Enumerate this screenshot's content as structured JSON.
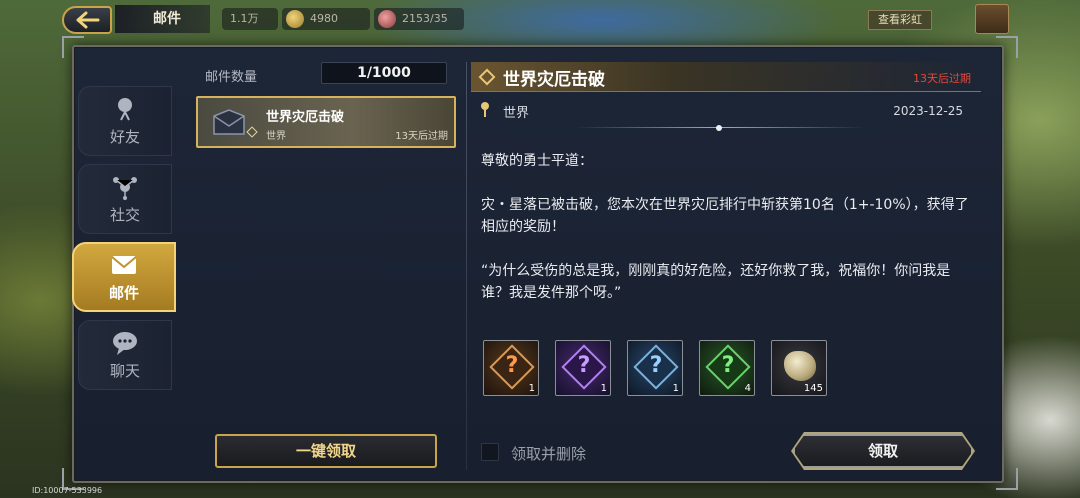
{
  "topbar": {
    "title": "邮件",
    "resource_1": "1.1万",
    "resource_2": "4980",
    "resource_3": "2153/35",
    "map_label": "查看彩虹"
  },
  "nav": {
    "items": [
      {
        "label": "好友",
        "icon": "pin-icon",
        "active": false
      },
      {
        "label": "社交",
        "icon": "network-icon",
        "active": false
      },
      {
        "label": "邮件",
        "icon": "envelope-icon",
        "active": true
      },
      {
        "label": "聊天",
        "icon": "speech-bubble-icon",
        "active": false
      }
    ]
  },
  "list": {
    "count_label": "邮件数量",
    "count_value": "1/1000",
    "items": [
      {
        "title": "世界灾厄击破",
        "source": "世界",
        "expiry": "13天后过期"
      }
    ],
    "claim_all_label": "一键领取"
  },
  "detail": {
    "title": "世界灾厄击破",
    "expiry": "13天后过期",
    "sender": "世界",
    "date": "2023-12-25",
    "greeting": "尊敬的勇士平道：",
    "paragraph_1": "灾・星落已被击破，您本次在世界灾厄排行中斩获第10名（1+-10%），获得了相应的奖励！",
    "paragraph_2": "“为什么受伤的总是我，刚刚真的好危险，还好你救了我，祝福你！你问我是谁？我是发件那个呀。”",
    "rewards": [
      {
        "name": "mystery-orange",
        "symbol": "?",
        "qty": "1",
        "color": "#d89a50"
      },
      {
        "name": "mystery-purple",
        "symbol": "?",
        "qty": "1",
        "color": "#b080f0"
      },
      {
        "name": "mystery-blue",
        "symbol": "?",
        "qty": "1",
        "color": "#7ab0da"
      },
      {
        "name": "mystery-green",
        "symbol": "?",
        "qty": "4",
        "color": "#6ad06a"
      },
      {
        "name": "ore",
        "symbol": "",
        "qty": "145",
        "color": "#d8cba0"
      }
    ],
    "delete_label": "领取并删除",
    "claim_label": "领取"
  },
  "footer": {
    "id": "ID:10007-533996"
  },
  "colors": {
    "accent_gold": "#c9a44a",
    "expiry_red": "#e04a3a",
    "panel_bg": "#1d2637"
  }
}
